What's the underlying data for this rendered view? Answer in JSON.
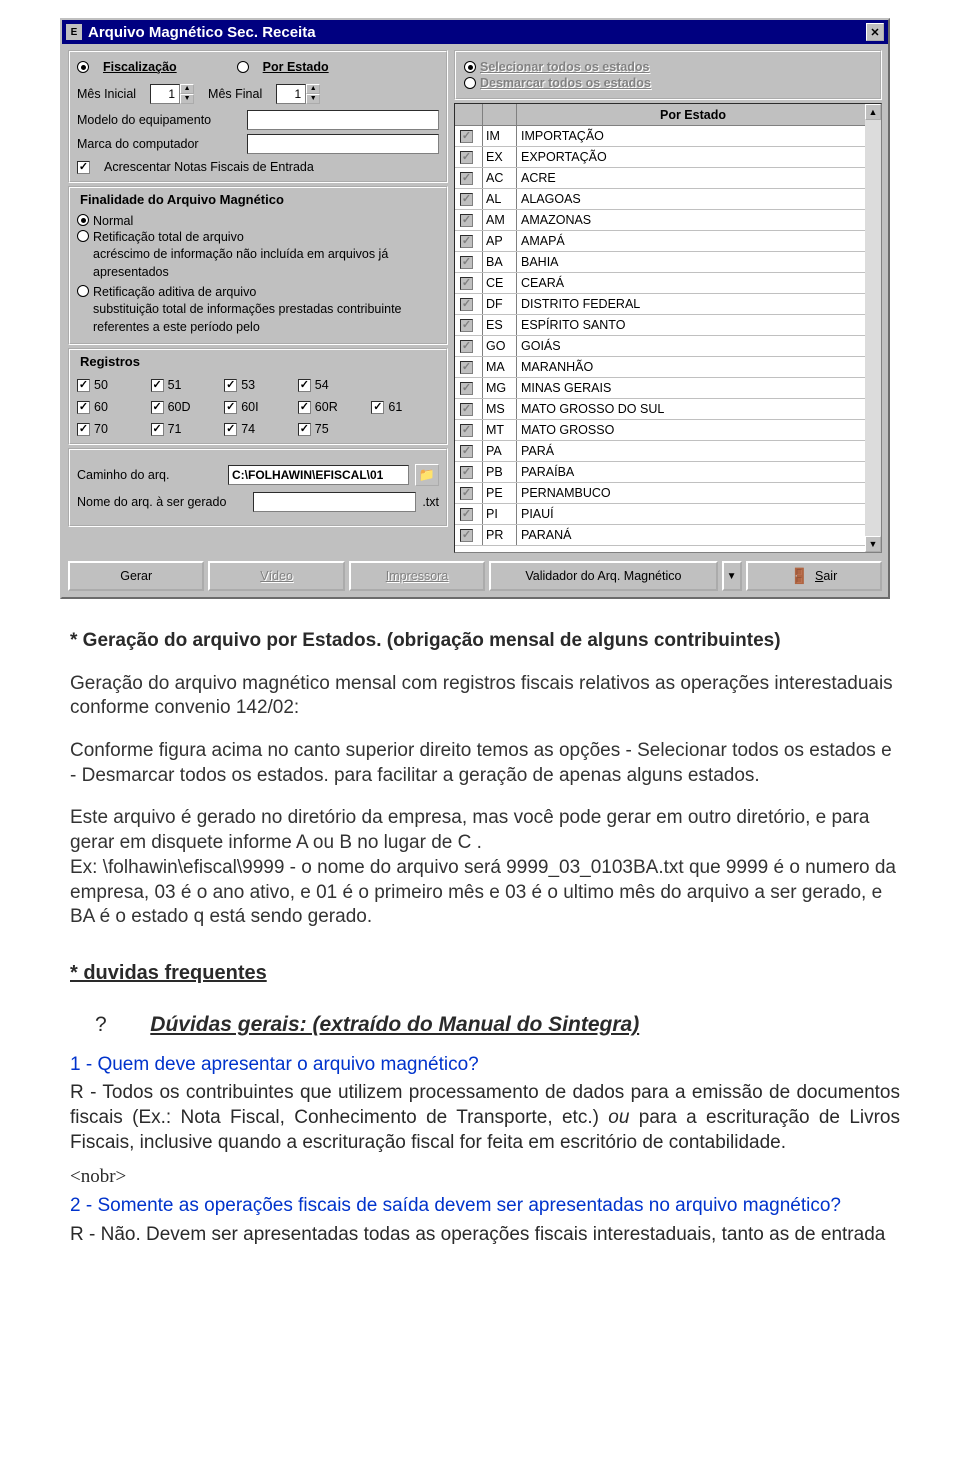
{
  "window": {
    "title": "Arquivo Magnético Sec. Receita",
    "icon_letter": "E"
  },
  "left": {
    "opt1": "Fiscalização",
    "opt2": "Por Estado",
    "mes_inicial_label": "Mês Inicial",
    "mes_inicial_value": "1",
    "mes_final_label": "Mês Final",
    "mes_final_value": "1",
    "modelo_label": "Modelo do equipamento",
    "marca_label": "Marca do computador",
    "acrescentar": "Acrescentar Notas Fiscais de Entrada"
  },
  "finalidade": {
    "title": "Finalidade do Arquivo Magnético",
    "normal": "Normal",
    "retif_total": "Retificação total de arquivo",
    "retif_total_desc": "acréscimo de informação não incluída em arquivos já apresentados",
    "retif_aditiva": "Retificação aditiva de arquivo",
    "retif_aditiva_desc": "substituição total de informações prestadas contribuinte referentes a este período  pelo"
  },
  "registros": {
    "title": "Registros",
    "items": [
      "50",
      "51",
      "53",
      "54",
      "",
      "60",
      "60D",
      "60I",
      "60R",
      "61",
      "70",
      "71",
      "74",
      "75",
      ""
    ]
  },
  "paths": {
    "caminho_label": "Caminho do arq.",
    "caminho_value": "C:\\FOLHAWIN\\EFISCAL\\01",
    "nome_label": "Nome do arq. à ser gerado",
    "nome_ext": ".txt"
  },
  "right": {
    "select_all": "Selecionar todos os estados",
    "deselect_all": "Desmarcar todos os estados",
    "header": "Por Estado",
    "states": [
      {
        "code": "IM",
        "name": "IMPORTAÇÃO"
      },
      {
        "code": "EX",
        "name": "EXPORTAÇÃO"
      },
      {
        "code": "AC",
        "name": "ACRE"
      },
      {
        "code": "AL",
        "name": "ALAGOAS"
      },
      {
        "code": "AM",
        "name": "AMAZONAS"
      },
      {
        "code": "AP",
        "name": "AMAPÁ"
      },
      {
        "code": "BA",
        "name": "BAHIA"
      },
      {
        "code": "CE",
        "name": "CEARÁ"
      },
      {
        "code": "DF",
        "name": "DISTRITO FEDERAL"
      },
      {
        "code": "ES",
        "name": "ESPÍRITO SANTO"
      },
      {
        "code": "GO",
        "name": "GOIÁS"
      },
      {
        "code": "MA",
        "name": "MARANHÃO"
      },
      {
        "code": "MG",
        "name": "MINAS GERAIS"
      },
      {
        "code": "MS",
        "name": "MATO GROSSO DO SUL"
      },
      {
        "code": "MT",
        "name": "MATO GROSSO"
      },
      {
        "code": "PA",
        "name": "PARÁ"
      },
      {
        "code": "PB",
        "name": "PARAÍBA"
      },
      {
        "code": "PE",
        "name": "PERNAMBUCO"
      },
      {
        "code": "PI",
        "name": "PIAUÍ"
      },
      {
        "code": "PR",
        "name": "PARANÁ"
      }
    ]
  },
  "buttons": {
    "gerar": "Gerar",
    "video": "Vídeo",
    "impressora": "Impressora",
    "validador": "Validador do Arq. Magnético",
    "sair": "Sair"
  },
  "doc": {
    "h1": "* Geração do  arquivo por Estados. (obrigação mensal de alguns  contribuintes)",
    "p1": "Geração do arquivo magnético mensal com registros fiscais relativos as operações interestaduais conforme convenio 142/02:",
    "p2": "Conforme figura acima no canto superior direito temos as opções - Selecionar todos os estados e - Desmarcar todos os estados. para facilitar a geração de apenas alguns estados.",
    "p3a": "Este arquivo é gerado no diretório da empresa, mas você pode gerar em outro diretório, e para gerar em disquete informe A ou B no lugar de C .",
    "p3b": "Ex: \\folhawin\\efiscal\\9999 -  o nome do arquivo será 9999_03_0103BA.txt que 9999 é o numero da empresa, 03 é o ano ativo, e 01 é o primeiro mês e 03 é o ultimo mês do arquivo a ser gerado, e BA é o estado q está sendo gerado.",
    "duvidas": "* duvidas frequentes",
    "qmark": "?",
    "duvidas_gerais": "Dúvidas gerais: (extraído do Manual do Sintegra)",
    "q1": "1 - Quem deve apresentar o arquivo magnético?",
    "a1": "R - Todos os contribuintes que utilizem processamento de dados para a emissão de documentos fiscais (Ex.: Nota Fiscal, Conhecimento de Transporte, etc.) ",
    "a1_italic": "ou",
    "a1_cont": " para a escrituração de Livros Fiscais, inclusive quando a escrituração fiscal for feita em escritório de contabilidade.",
    "nobr": "<nobr>",
    "q2": "2 - Somente as operações fiscais de saída devem ser apresentadas no arquivo magnético?",
    "a2": "R - Não.  Devem  ser  apresentadas  todas  as  operações  fiscais  interestaduais,  tanto  as  de  entrada"
  }
}
